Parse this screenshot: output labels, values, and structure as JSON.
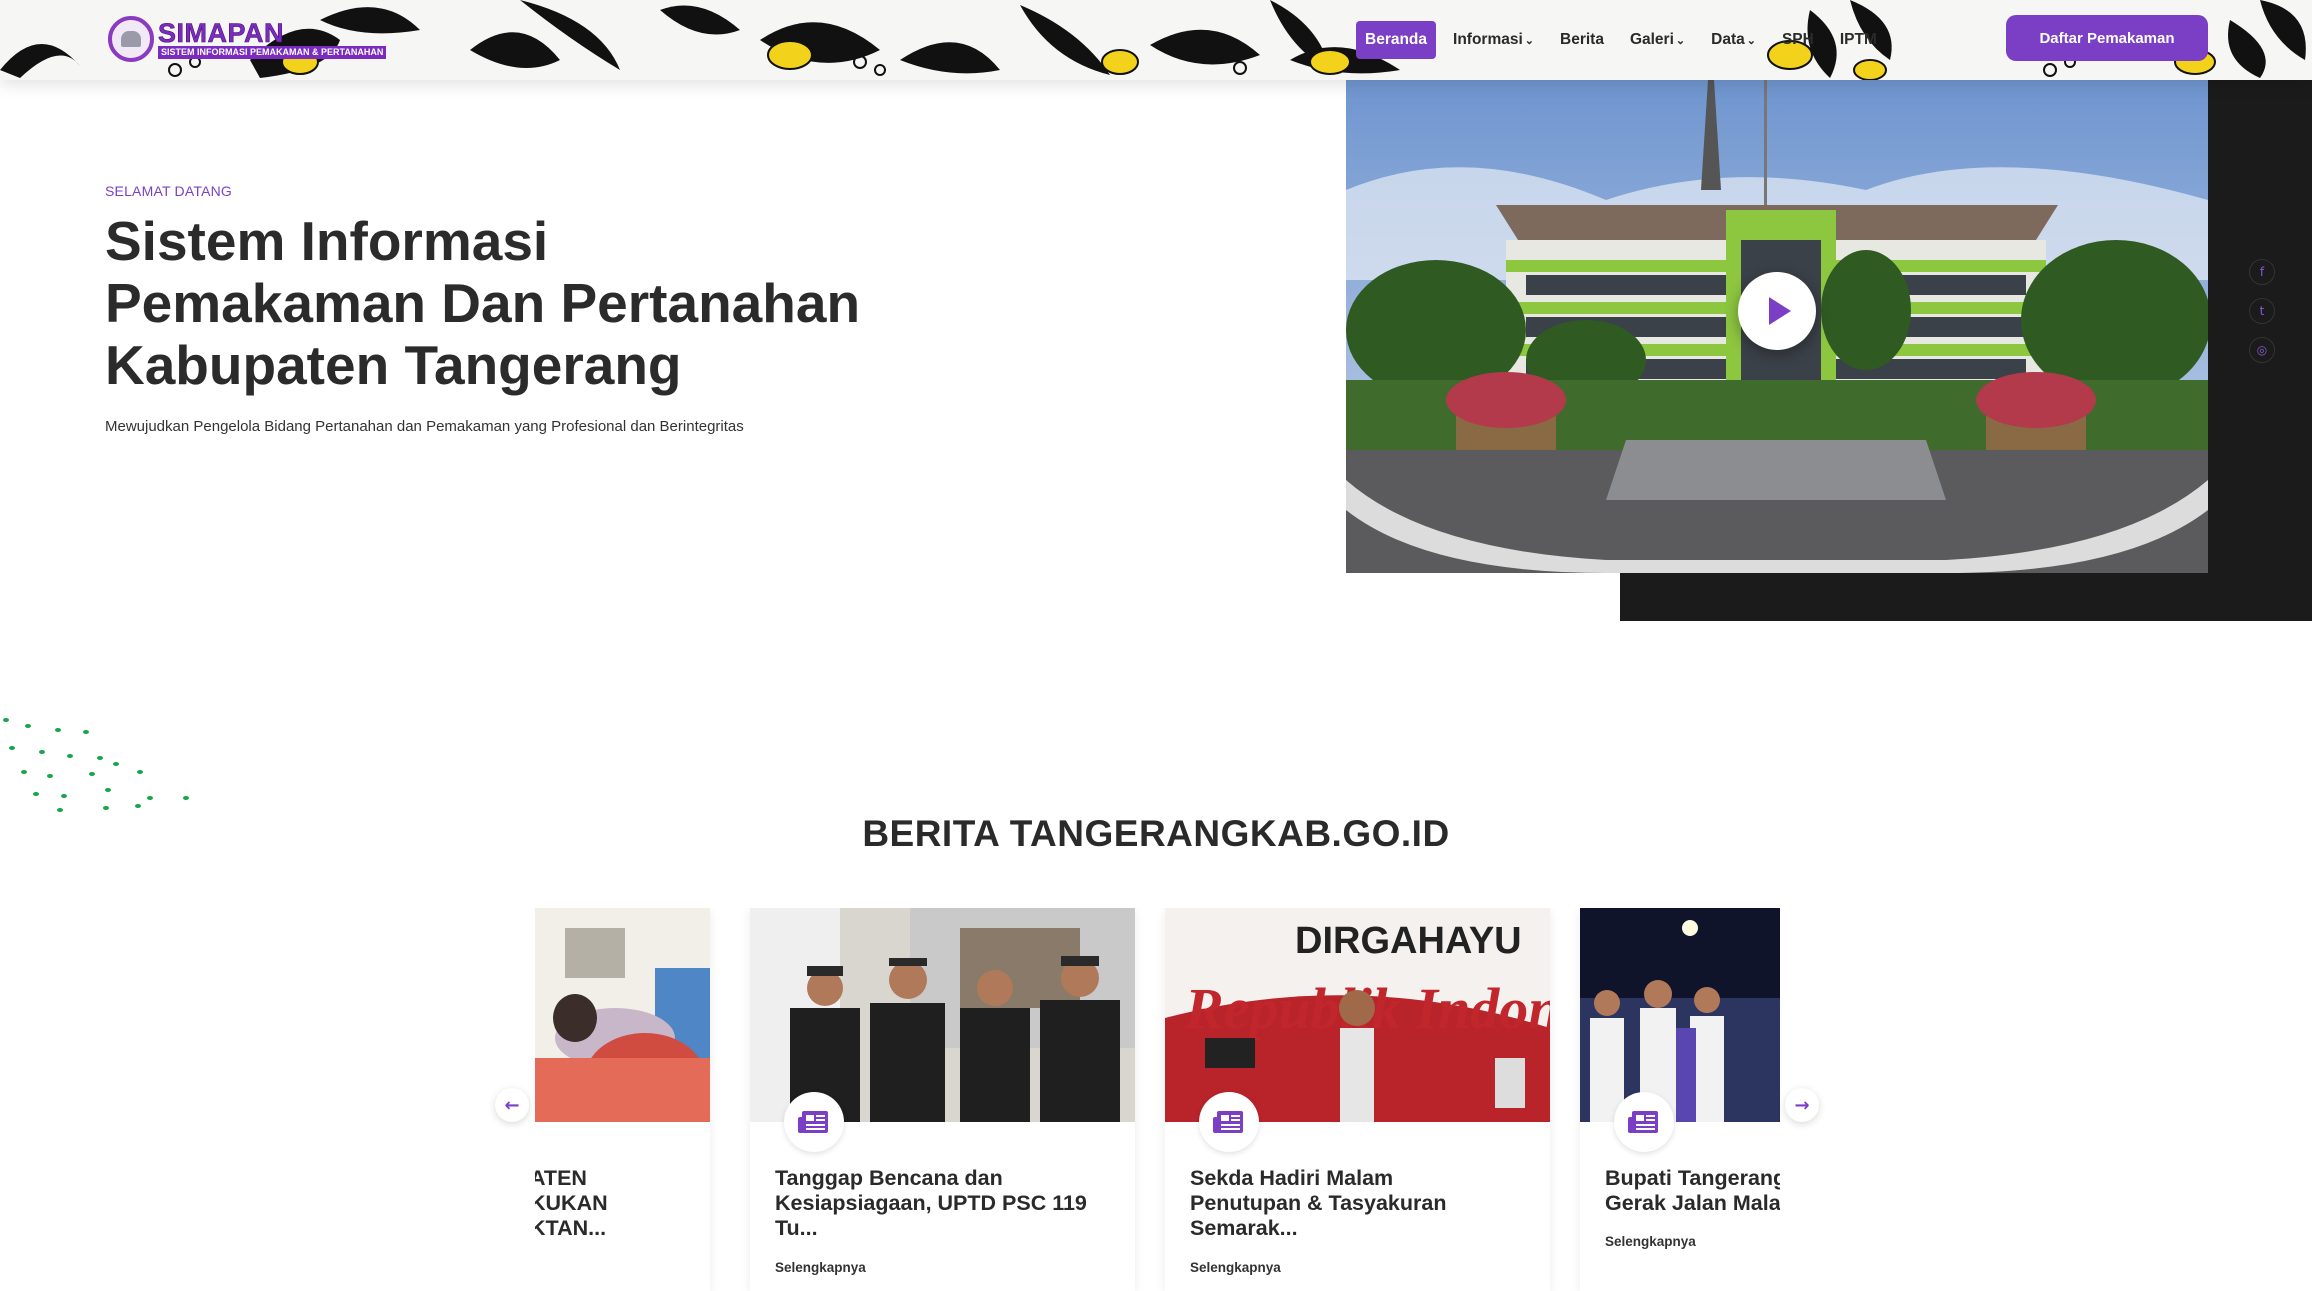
{
  "brand": {
    "name": "SIMAPAN",
    "tagline": "SISTEM INFORMASI PEMAKAMAN & PERTANAHAN"
  },
  "nav": {
    "items": [
      {
        "label": "Beranda",
        "active": true,
        "dropdown": false
      },
      {
        "label": "Informasi",
        "active": false,
        "dropdown": true
      },
      {
        "label": "Berita",
        "active": false,
        "dropdown": false
      },
      {
        "label": "Galeri",
        "active": false,
        "dropdown": true
      },
      {
        "label": "Data",
        "active": false,
        "dropdown": true
      },
      {
        "label": "SPH",
        "active": false,
        "dropdown": false
      },
      {
        "label": "IPTM",
        "active": false,
        "dropdown": false
      }
    ],
    "cta_label": "Daftar Pemakaman"
  },
  "hero": {
    "kicker": "SELAMAT DATANG",
    "title_lines": [
      "Sistem Informasi",
      "Pemakaman Dan Pertanahan",
      "Kabupaten Tangerang"
    ],
    "subtitle": "Mewujudkan Pengelola Bidang Pertanahan dan Pemakaman yang Profesional dan Berintegritas",
    "social_icons": [
      "facebook-icon",
      "twitter-icon",
      "instagram-icon"
    ]
  },
  "news": {
    "section_title": "BERITA TANGERANGKAB.GO.ID",
    "cards": [
      {
        "title_lines": [
          "ATEN",
          "KUKAN",
          "KTAN..."
        ],
        "more": "Selengkapnya"
      },
      {
        "title_lines": [
          "Tanggap Bencana dan",
          "Kesiapsiagaan, UPTD PSC 119",
          "Tu..."
        ],
        "more": "Selengkapnya"
      },
      {
        "title_lines": [
          "Sekda Hadiri Malam",
          "Penutupan & Tasyakuran",
          "Semarak..."
        ],
        "more": "Selengkapnya"
      },
      {
        "title_lines": [
          "Bupati Tangerang",
          "Gerak Jalan Malam"
        ],
        "more": "Selengkapnya"
      }
    ],
    "photo_caption_banner": "DIRGAHAYU",
    "photo_caption_script": "Republik Indonesia",
    "prev_icon": "arrow-left-icon",
    "next_icon": "arrow-right-icon"
  },
  "colors": {
    "accent": "#7b3fc6",
    "dark_panel": "#1b1b1b",
    "leaf_green": "#1aa34a"
  }
}
